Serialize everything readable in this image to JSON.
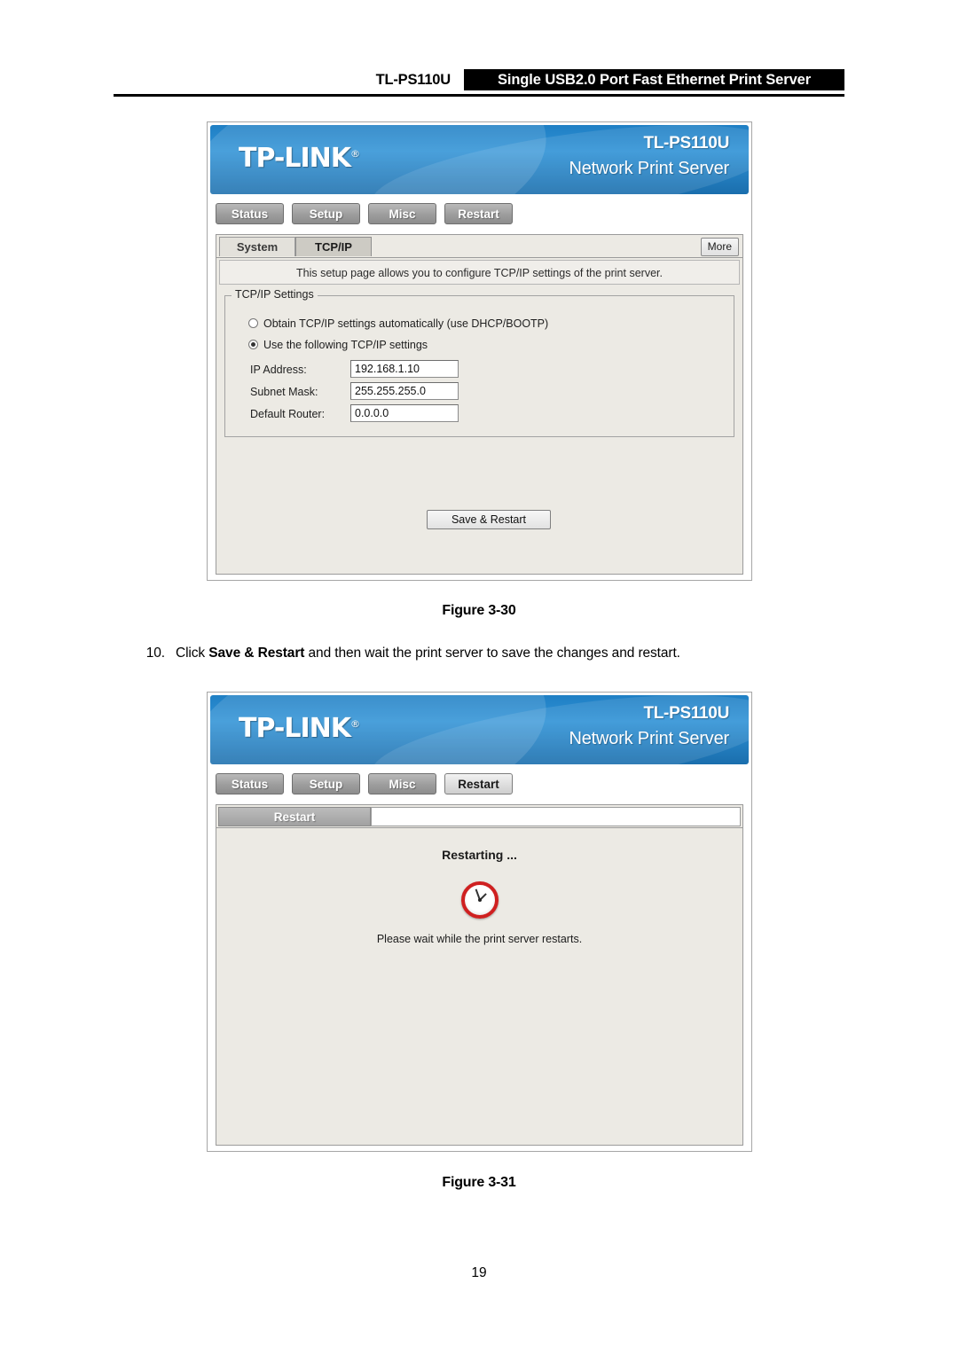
{
  "header": {
    "model": "TL-PS110U",
    "title": "Single USB2.0 Port Fast Ethernet Print Server"
  },
  "figure1": {
    "banner": {
      "logo": "TP-LINK",
      "model": "TL-PS110U",
      "subtitle": "Network Print Server"
    },
    "nav_tabs": [
      {
        "label": "Status",
        "active": false
      },
      {
        "label": "Setup",
        "active": false
      },
      {
        "label": "Misc",
        "active": false
      },
      {
        "label": "Restart",
        "active": false
      }
    ],
    "sub_tabs": [
      {
        "label": "System",
        "selected": false
      },
      {
        "label": "TCP/IP",
        "selected": true
      }
    ],
    "more_button": "More",
    "description": "This setup page allows you to configure TCP/IP settings of the print server.",
    "fieldset_legend": "TCP/IP Settings",
    "radio_auto": "Obtain TCP/IP settings automatically (use DHCP/BOOTP)",
    "radio_manual": "Use the following TCP/IP settings",
    "fields": [
      {
        "label": "IP Address:",
        "value": "192.168.1.10"
      },
      {
        "label": "Subnet Mask:",
        "value": "255.255.255.0"
      },
      {
        "label": "Default Router:",
        "value": "0.0.0.0"
      }
    ],
    "save_button": "Save & Restart",
    "caption": "Figure 3-30"
  },
  "step": {
    "number": "10.",
    "text_before": "Click ",
    "bold": "Save & Restart",
    "text_after": " and then wait the print server to save the changes and restart."
  },
  "figure2": {
    "banner": {
      "logo": "TP-LINK",
      "model": "TL-PS110U",
      "subtitle": "Network Print Server"
    },
    "nav_tabs": [
      {
        "label": "Status",
        "active": false
      },
      {
        "label": "Setup",
        "active": false
      },
      {
        "label": "Misc",
        "active": false
      },
      {
        "label": "Restart",
        "active": true
      }
    ],
    "panel_tab": "Restart",
    "restarting_title": "Restarting ...",
    "restart_message": "Please wait while the print server restarts.",
    "caption": "Figure 3-31"
  },
  "page_number": "19"
}
